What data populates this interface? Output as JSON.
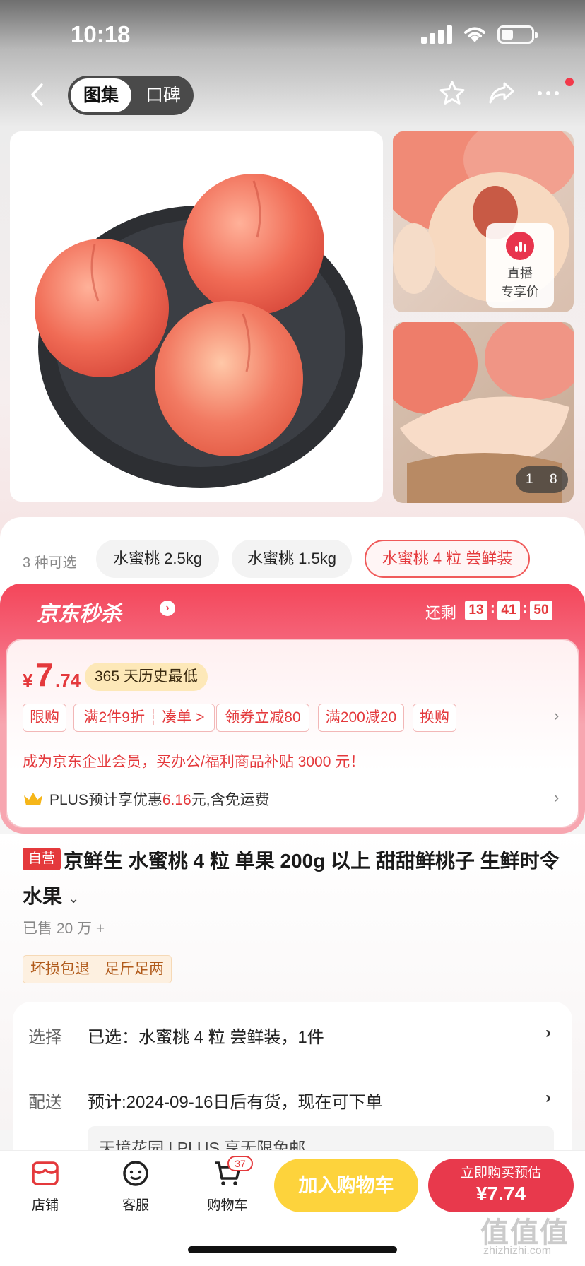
{
  "status": {
    "time": "10:18"
  },
  "nav": {
    "tab_gallery": "图集",
    "tab_reviews": "口碑"
  },
  "gallery": {
    "live_line1": "直播",
    "live_line2": "专享价",
    "pager_current": "1",
    "pager_total": "8"
  },
  "variants": {
    "label": "3 种可选",
    "options": [
      "水蜜桃 2.5kg",
      "水蜜桃 1.5kg",
      "水蜜桃 4 粒 尝鲜装"
    ],
    "selected_index": 2
  },
  "flash_sale": {
    "title": "京东秒杀",
    "countdown_label": "还剩",
    "hours": "13",
    "minutes": "41",
    "seconds": "50"
  },
  "price": {
    "symbol": "¥",
    "integer": "7",
    "decimal": ".74",
    "history_badge": "365 天历史最低"
  },
  "promos": [
    "限购",
    "满2件9折",
    "凑单 >",
    "领券立减80",
    "满200减20",
    "换购"
  ],
  "corporate_offer": "成为京东企业会员，买办公/福利商品补贴 3000 元！",
  "plus": {
    "prefix": "PLUS预计享优惠",
    "amount": "6.16",
    "suffix": "元,含免运费"
  },
  "product": {
    "self_tag": "自营",
    "title": "京鲜生 水蜜桃 4 粒 单果 200g 以上 甜甜鲜桃子 生鲜时令水果",
    "sold": "已售 20 万 +",
    "guarantees": [
      "坏损包退",
      "足斤足两"
    ]
  },
  "details": {
    "select_label": "选择",
    "select_value": "已选：水蜜桃 4 粒 尝鲜装，1件",
    "delivery_label": "配送",
    "delivery_value": "预计:2024-09-16日后有货，现在可下单",
    "address_partial": "天境花园 | PLUS 享无限免邮"
  },
  "bottom_bar": {
    "store": "店铺",
    "service": "客服",
    "cart": "购物车",
    "cart_count": "37",
    "add_to_cart": "加入购物车",
    "buy_now_line1": "立即购买预估",
    "buy_now_price": "¥7.74"
  },
  "watermark": {
    "main": "值值值",
    "sub": "zhizhizhi.com"
  },
  "colors": {
    "accent_red": "#e4393c",
    "flash_red": "#f4465a",
    "add_cart_yellow": "#fdd33c"
  }
}
